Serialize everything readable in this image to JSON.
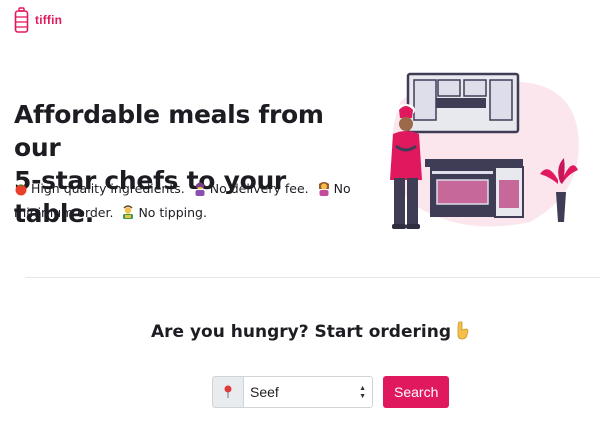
{
  "brand": {
    "name": "tiffin",
    "icon": "tiffin-box-icon",
    "color": "#e0195f"
  },
  "hero": {
    "title_line1": "Affordable meals from our",
    "title_line2": "5-star chefs to your table.",
    "features": [
      {
        "icon": "tomato-emoji",
        "text": "High quality ingredients."
      },
      {
        "icon": "delivery-person-emoji",
        "text": "No delivery fee."
      },
      {
        "icon": "tipping-hand-emoji",
        "text": "No minimum order."
      },
      {
        "icon": "no-money-emoji",
        "text": "No tipping."
      }
    ]
  },
  "illustration": {
    "icon": "chef-kitchen-illustration"
  },
  "order": {
    "heading": "Are you hungry? Start ordering",
    "heading_icon": "pointing-down-emoji",
    "location_icon": "pin-icon",
    "location_value": "Seef",
    "search_label": "Search"
  },
  "colors": {
    "accent": "#e0195f",
    "text": "#1c1c22",
    "blob": "#fbe6ee"
  }
}
